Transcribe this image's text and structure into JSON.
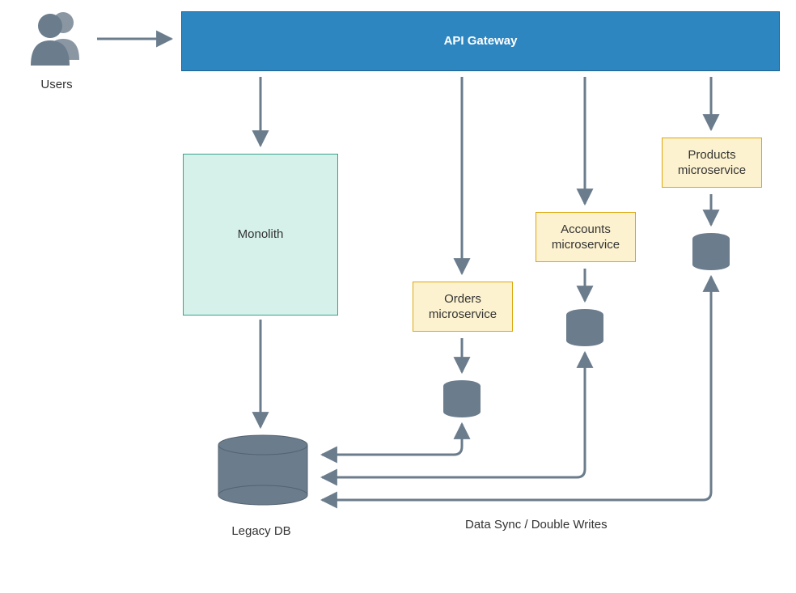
{
  "labels": {
    "users": "Users",
    "api_gateway": "API Gateway",
    "monolith": "Monolith",
    "orders_ms": "Orders\nmicroservice",
    "accounts_ms": "Accounts\nmicroservice",
    "products_ms": "Products\nmicroservice",
    "legacy_db": "Legacy DB",
    "data_sync": "Data Sync / Double Writes"
  },
  "colors": {
    "arrow": "#6b7c8c",
    "gateway_fill": "#2e86c1",
    "gateway_stroke": "#1f618d",
    "monolith_fill": "#d5f1ea",
    "monolith_stroke": "#3aa38d",
    "ms_fill": "#fdf2cf",
    "ms_stroke": "#dca70d",
    "db_fill": "#6b7c8c"
  },
  "diagram": {
    "type": "architecture",
    "nodes": [
      {
        "id": "users",
        "kind": "actor",
        "label": "Users"
      },
      {
        "id": "gateway",
        "kind": "component",
        "label": "API Gateway"
      },
      {
        "id": "monolith",
        "kind": "component",
        "label": "Monolith"
      },
      {
        "id": "orders",
        "kind": "microservice",
        "label": "Orders microservice"
      },
      {
        "id": "accounts",
        "kind": "microservice",
        "label": "Accounts microservice"
      },
      {
        "id": "products",
        "kind": "microservice",
        "label": "Products microservice"
      },
      {
        "id": "legacy_db",
        "kind": "database",
        "label": "Legacy DB"
      },
      {
        "id": "orders_db",
        "kind": "database",
        "label": ""
      },
      {
        "id": "accounts_db",
        "kind": "database",
        "label": ""
      },
      {
        "id": "products_db",
        "kind": "database",
        "label": ""
      }
    ],
    "edges": [
      {
        "from": "users",
        "to": "gateway"
      },
      {
        "from": "gateway",
        "to": "monolith"
      },
      {
        "from": "gateway",
        "to": "orders"
      },
      {
        "from": "gateway",
        "to": "accounts"
      },
      {
        "from": "gateway",
        "to": "products"
      },
      {
        "from": "monolith",
        "to": "legacy_db"
      },
      {
        "from": "orders",
        "to": "orders_db"
      },
      {
        "from": "accounts",
        "to": "accounts_db"
      },
      {
        "from": "products",
        "to": "products_db"
      },
      {
        "from": "orders_db",
        "to": "legacy_db",
        "label": "Data Sync / Double Writes",
        "bidirectional": true
      },
      {
        "from": "accounts_db",
        "to": "legacy_db",
        "bidirectional": true
      },
      {
        "from": "products_db",
        "to": "legacy_db",
        "bidirectional": true
      }
    ]
  }
}
